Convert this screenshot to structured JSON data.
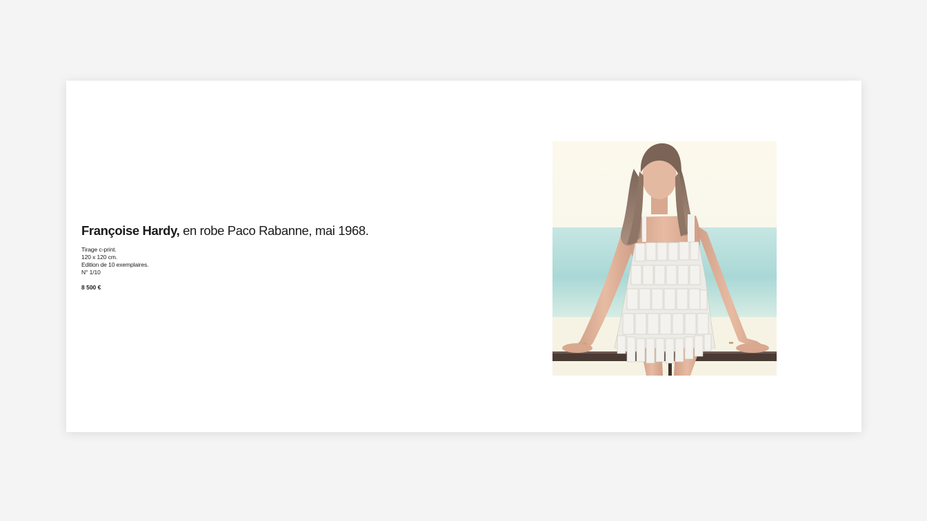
{
  "artwork": {
    "title_bold": "Françoise Hardy,",
    "title_rest": " en robe Paco Rabanne, mai 1968.",
    "details": [
      "Tirage c-print.",
      "120 x 120 cm.",
      "Edition de 10 exemplaires.",
      "N° 1/10"
    ],
    "price": "8 500 €"
  },
  "photo": {
    "icon": "photograph-image",
    "colors": {
      "sky": "#fbf8ea",
      "sea": "#bfe3e0",
      "dress": "#f4f3ef",
      "skin": "#e2b49c",
      "hair": "#8e7565",
      "railing": "#4a3a34"
    }
  }
}
